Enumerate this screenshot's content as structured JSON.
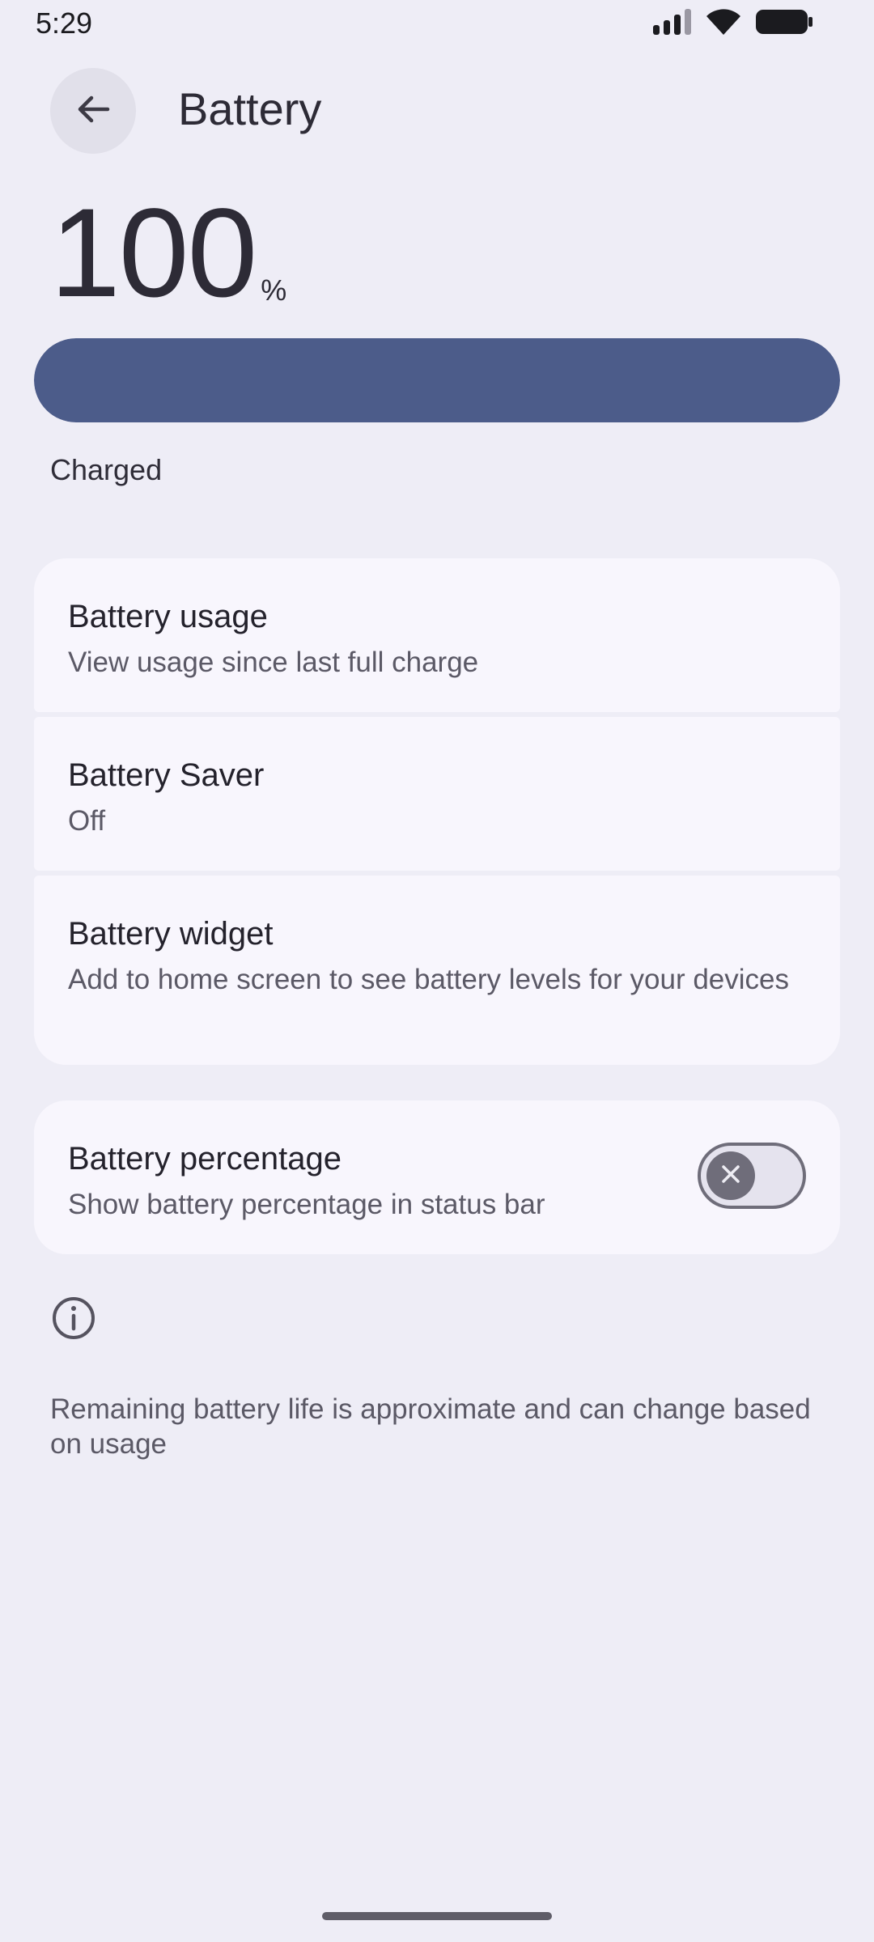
{
  "status_bar": {
    "time": "5:29",
    "icons": [
      "signal-icon",
      "wifi-icon",
      "battery-icon"
    ]
  },
  "header": {
    "back_icon": "arrow-back-icon",
    "title": "Battery"
  },
  "battery": {
    "level_number": "100",
    "level_unit": "%",
    "level_fraction": 1.0,
    "bar_color": "#4c5c8a",
    "status": "Charged"
  },
  "settings": {
    "usage": {
      "title": "Battery usage",
      "subtitle": "View usage since last full charge"
    },
    "saver": {
      "title": "Battery Saver",
      "subtitle": "Off"
    },
    "widget": {
      "title": "Battery widget",
      "subtitle": "Add to home screen to see battery levels for your devices"
    },
    "percentage": {
      "title": "Battery percentage",
      "subtitle": "Show battery percentage in status bar",
      "enabled": false
    }
  },
  "footer": {
    "info_icon": "info-icon",
    "note": "Remaining battery life is approximate and can change based on usage"
  },
  "colors": {
    "background": "#eeedf6",
    "card": "#f8f6fd",
    "accent": "#4c5c8a"
  }
}
